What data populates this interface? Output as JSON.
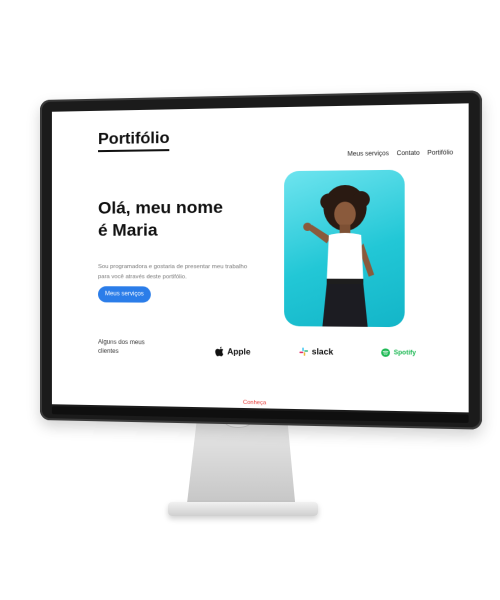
{
  "site": {
    "logo": "Portifólio",
    "nav": [
      {
        "label": "Meus serviços"
      },
      {
        "label": "Contato"
      },
      {
        "label": "Portifólio"
      }
    ],
    "hero": {
      "title_line1": "Olá, meu nome",
      "title_line2": "é Maria",
      "description": "Sou programadora e gostaria de presentar meu trabalho para você através deste portifólio.",
      "cta_label": "Meus serviços"
    },
    "clients": {
      "label": "Alguns dos meus clientes",
      "logos": [
        {
          "name": "Apple",
          "icon": "apple-icon"
        },
        {
          "name": "slack",
          "icon": "slack-icon"
        },
        {
          "name": "Spotify",
          "icon": "spotify-icon"
        }
      ]
    },
    "footer_link": "Conheça"
  },
  "colors": {
    "accent": "#2b7de9",
    "photo_bg": "#22c7d6",
    "footer_link": "#e53935",
    "spotify": "#1db954"
  }
}
